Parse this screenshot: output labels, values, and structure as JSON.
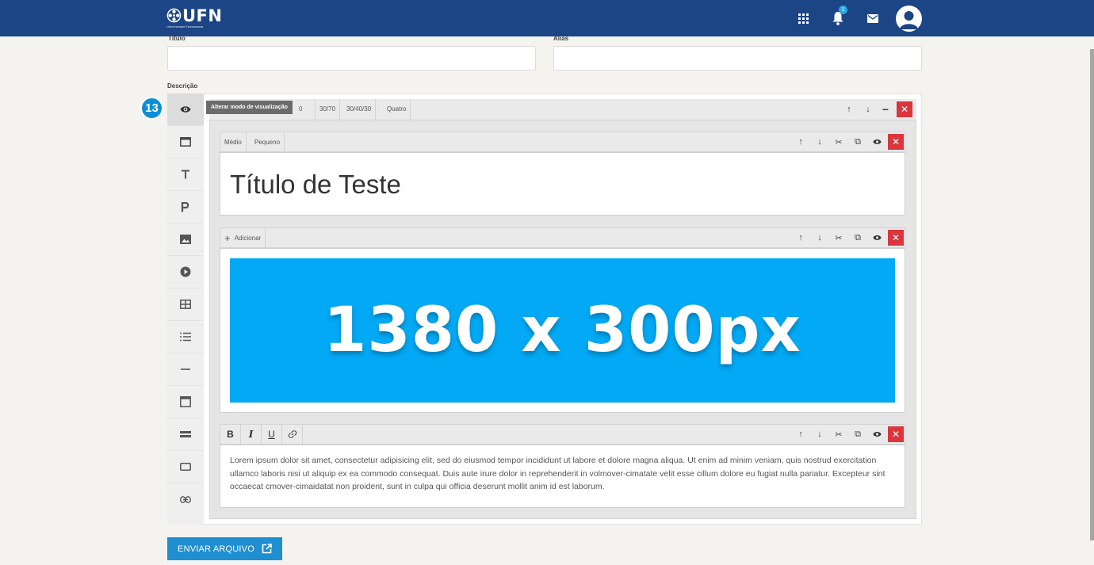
{
  "header": {
    "logo_text": "UFN",
    "logo_sub": "Universidade Franciscana",
    "notification_count": "1",
    "icons": [
      "apps-icon",
      "bell-icon",
      "mail-icon",
      "avatar-icon"
    ]
  },
  "form": {
    "titulo_label": "Título",
    "alias_label": "Alias",
    "titulo_value": "",
    "alias_value": "",
    "descricao_label": "Descrição"
  },
  "step_badge": "13",
  "tooltip": "Alterar modo de visualização",
  "row_toolbar": {
    "layouts": [
      "30/70",
      "30/40/30",
      "Quatro"
    ],
    "hidden_fragment": "0"
  },
  "rail_icons": [
    "eye-icon",
    "window-icon",
    "title-icon",
    "paragraph-icon",
    "image-icon",
    "video-icon",
    "table-icon",
    "list-icon",
    "divider-icon",
    "box-icon",
    "bar-icon",
    "button-icon",
    "link-icon"
  ],
  "block_title": {
    "sizes": [
      "Médio",
      "Pequeno"
    ],
    "text": "Título de Teste"
  },
  "block_image": {
    "add_label": "Adicionar",
    "banner_text": "1380 x 300px"
  },
  "block_paragraph": {
    "format_buttons": [
      "B",
      "I",
      "U",
      "link"
    ],
    "text": "Lorem ipsum dolor sit amet, consectetur adipisicing elit, sed do eiusmod tempor incididunt ut labore et dolore magna aliqua. Ut enim ad minim veniam, quis nostrud exercitation ullamco laboris nisi ut aliquip ex ea commodo consequat. Duis aute irure dolor in reprehenderit in volmover-cimatate velit esse cillum dolore eu fugiat nulla pariatur. Excepteur sint occaecat cmover-cimaidatat non proident, sunt in culpa qui officia deserunt mollit anim id est laborum."
  },
  "submit": {
    "label": "ENVIAR ARQUIVO"
  },
  "colors": {
    "header_bg": "#1b4584",
    "banner_bg": "#03a9f4",
    "close_red": "#d9363e",
    "accent_blue": "#1f8fd1"
  }
}
